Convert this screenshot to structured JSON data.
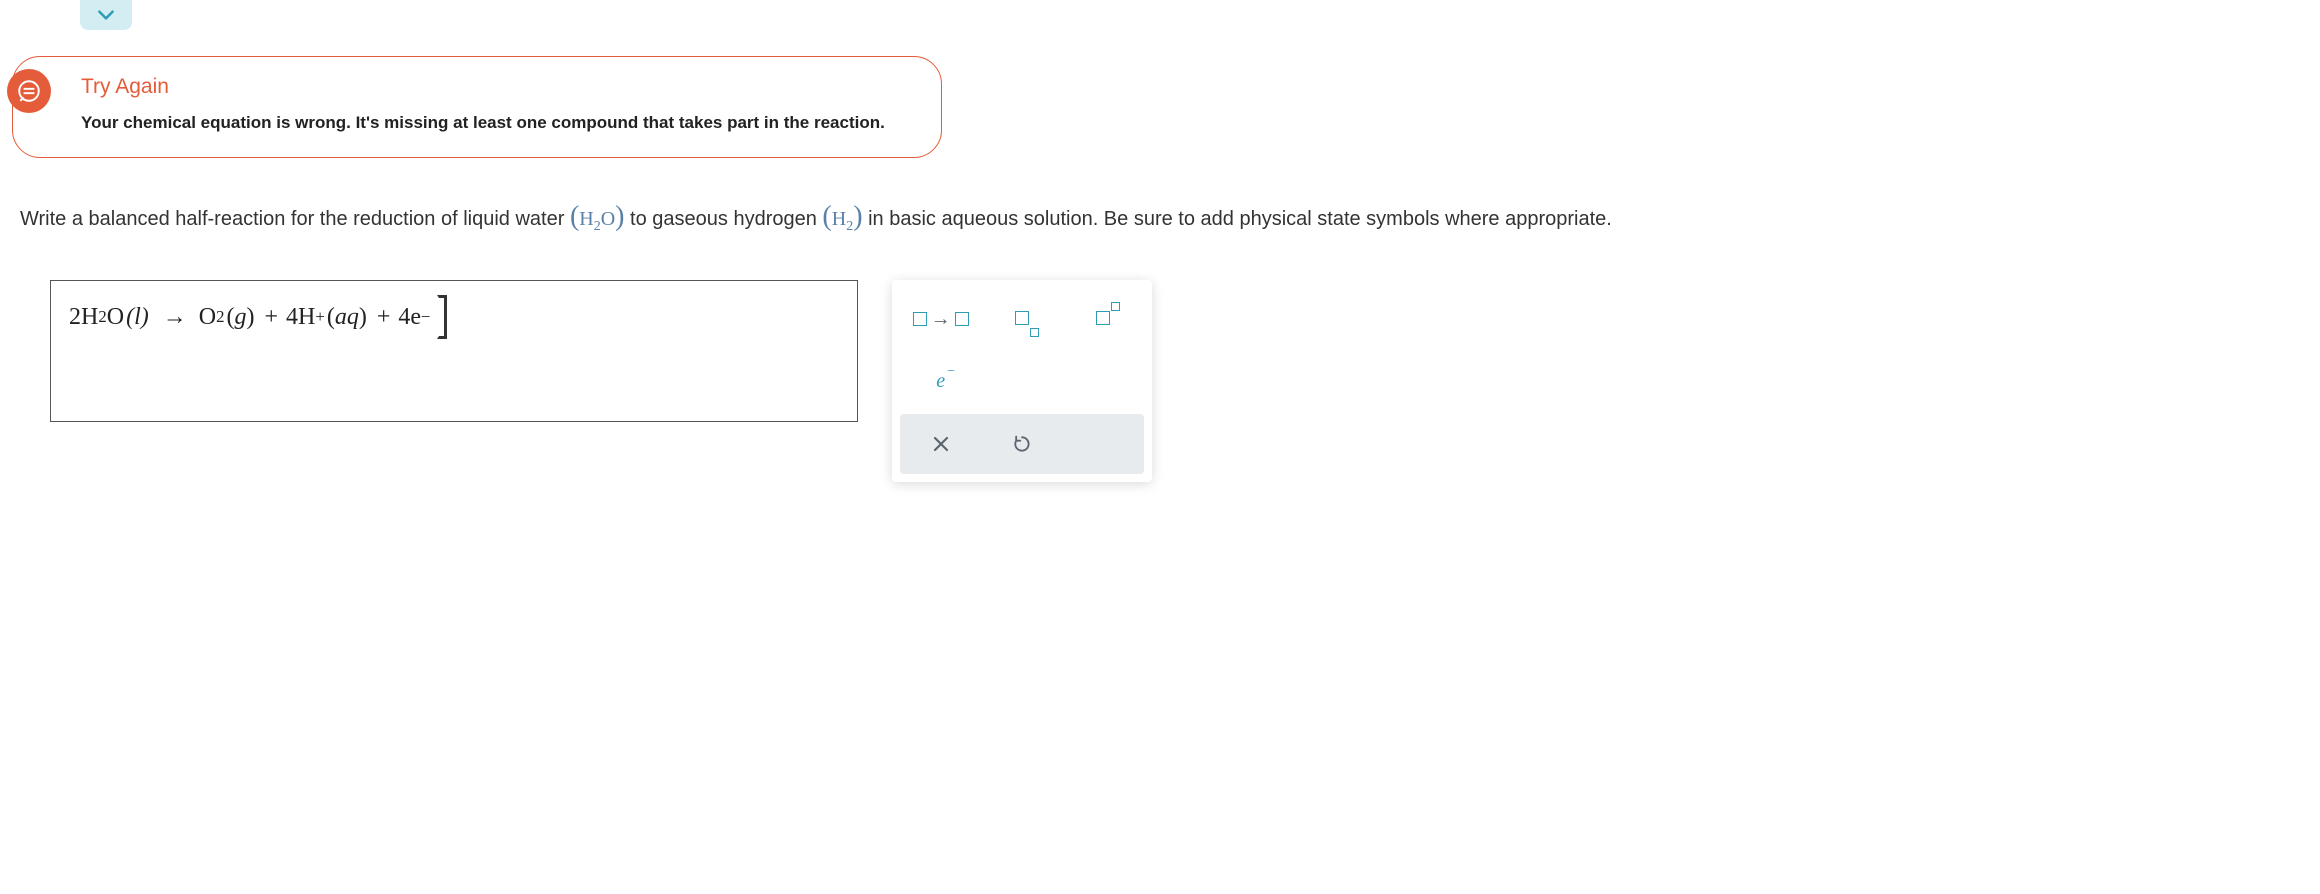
{
  "expand": {
    "icon": "chevron-down"
  },
  "feedback": {
    "title": "Try Again",
    "message": "Your chemical equation is wrong. It's missing at least one compound that takes part in the reaction."
  },
  "question": {
    "part1": "Write a balanced half-reaction for the reduction of liquid water ",
    "formula1_open": "(",
    "formula1_main": "H",
    "formula1_sub": "2",
    "formula1_end": "O",
    "formula1_close": ")",
    "part2": " to gaseous hydrogen ",
    "formula2_open": "(",
    "formula2_main": "H",
    "formula2_sub": "2",
    "formula2_close": ")",
    "part3": " in basic aqueous solution. Be sure to add physical state symbols where appropriate."
  },
  "answer": {
    "coef1": "2H",
    "sub1": "2",
    "o1": "O",
    "state1": "(l)",
    "arrow": "→",
    "o2": "O",
    "sub2": "2",
    "state2": "(g)",
    "plus1": "+",
    "coef4h": "4H",
    "supplus": "+",
    "state3": "(aq)",
    "plus2": "+",
    "coef4e": "4e",
    "supminus": "−"
  },
  "palette": {
    "electron": "e",
    "clear": "×",
    "reset": "↺"
  }
}
